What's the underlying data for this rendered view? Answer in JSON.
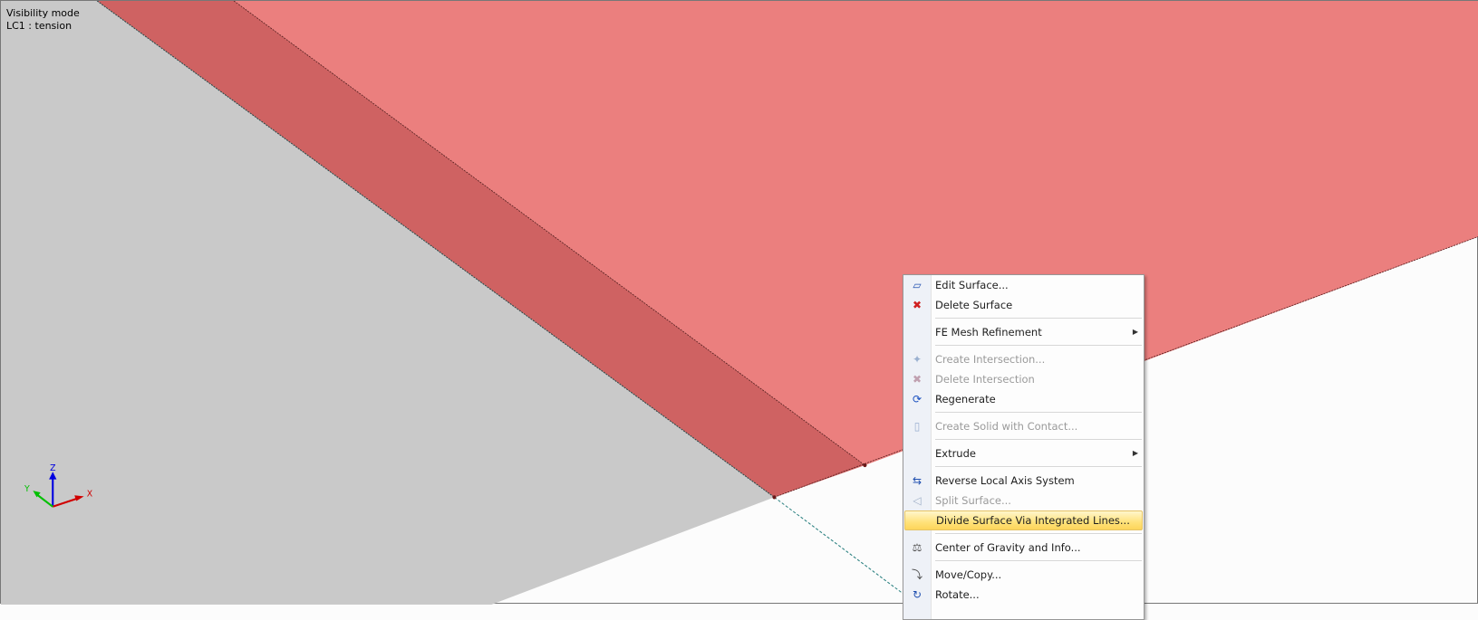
{
  "overlay": {
    "line1": "Visibility mode",
    "line2": "LC1 : tension"
  },
  "axes": {
    "x": "X",
    "y": "Y",
    "z": "Z"
  },
  "colors": {
    "surface_gray": "#c9c9c9",
    "surface_dark_red": "#cf6262",
    "surface_light_red": "#eb7f7e",
    "highlight": "#ffe27a"
  },
  "menu": {
    "edit_surface": "Edit Surface...",
    "delete_surface": "Delete Surface",
    "fe_mesh": "FE Mesh Refinement",
    "create_intersection": "Create Intersection...",
    "delete_intersection": "Delete Intersection",
    "regenerate": "Regenerate",
    "create_solid": "Create Solid with Contact...",
    "extrude": "Extrude",
    "reverse_axis": "Reverse Local Axis System",
    "split_surface": "Split Surface...",
    "divide_surface": "Divide Surface Via Integrated Lines...",
    "center_gravity": "Center of Gravity and Info...",
    "move_copy": "Move/Copy...",
    "rotate": "Rotate..."
  }
}
